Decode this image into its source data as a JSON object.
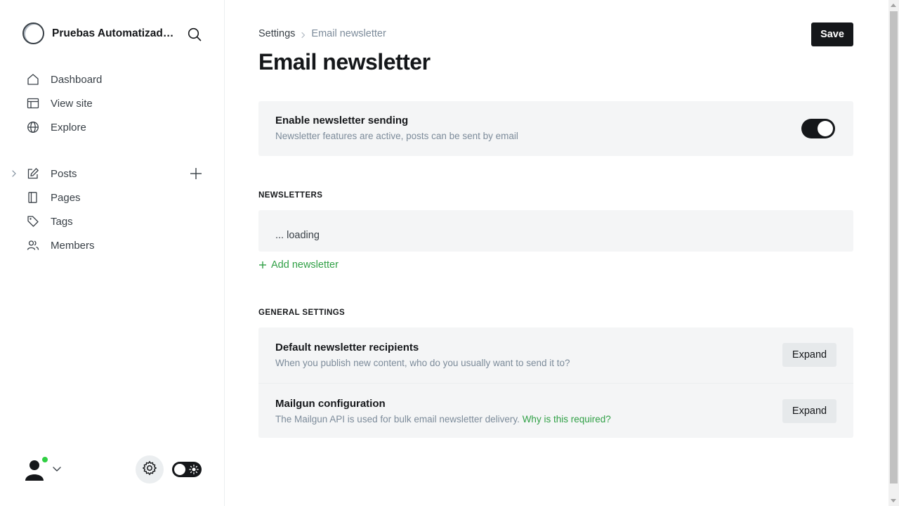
{
  "sidebar": {
    "site_name": "Pruebas Automatizadas",
    "nav_primary": [
      {
        "label": "Dashboard",
        "icon": "home-icon"
      },
      {
        "label": "View site",
        "icon": "layout-icon"
      },
      {
        "label": "Explore",
        "icon": "globe-icon"
      }
    ],
    "nav_content": [
      {
        "label": "Posts",
        "icon": "pen-icon"
      },
      {
        "label": "Pages",
        "icon": "pages-icon"
      },
      {
        "label": "Tags",
        "icon": "tag-icon"
      },
      {
        "label": "Members",
        "icon": "members-icon"
      }
    ],
    "user_status": "online",
    "theme": "dark"
  },
  "main": {
    "breadcrumb": {
      "root": "Settings",
      "current": "Email newsletter"
    },
    "save_label": "Save",
    "title": "Email newsletter",
    "enable_card": {
      "title": "Enable newsletter sending",
      "description": "Newsletter features are active, posts can be sent by email",
      "enabled": true
    },
    "newsletters": {
      "section_label": "NEWSLETTERS",
      "loading_text": "... loading",
      "add_label": "Add newsletter"
    },
    "general": {
      "section_label": "GENERAL SETTINGS",
      "items": [
        {
          "title": "Default newsletter recipients",
          "description": "When you publish new content, who do you usually want to send it to?",
          "button": "Expand"
        },
        {
          "title": "Mailgun configuration",
          "description": "The Mailgun API is used for bulk email newsletter delivery.",
          "link": "Why is this required?",
          "button": "Expand"
        }
      ]
    }
  },
  "colors": {
    "accent_green": "#30a046",
    "dark": "#15171a",
    "card_bg": "#f4f5f6",
    "muted_text": "#7c8b9a",
    "online_dot": "#30cf43"
  }
}
